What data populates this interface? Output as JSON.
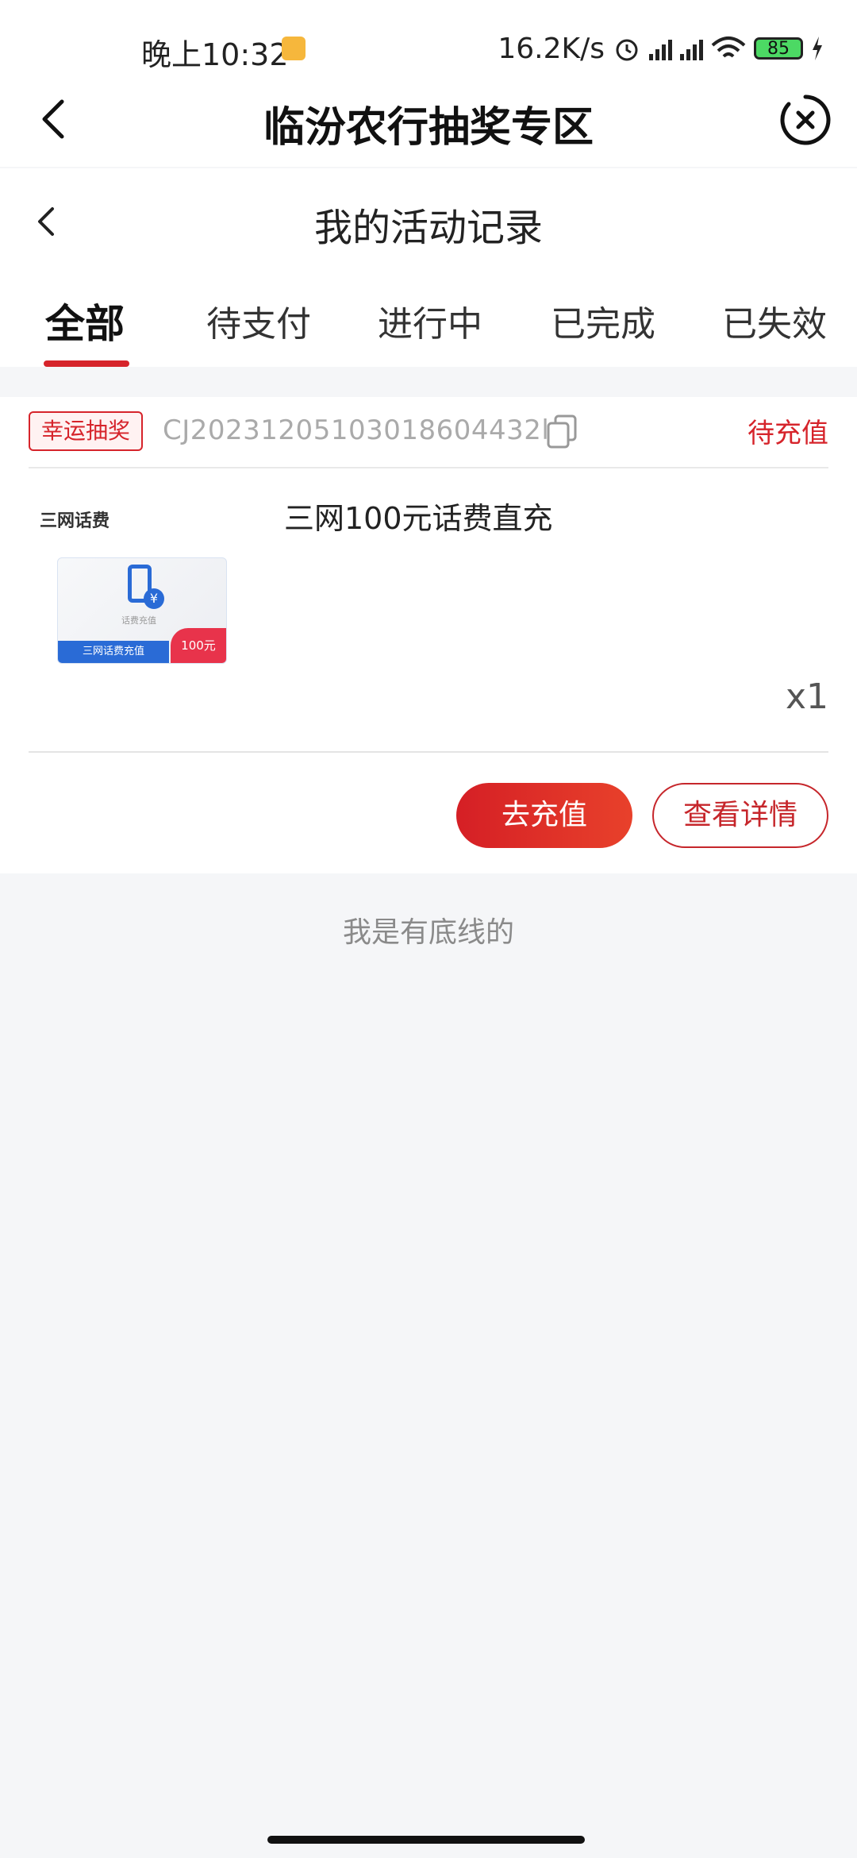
{
  "status_bar": {
    "time": "晚上10:32",
    "network_speed": "16.2K/s",
    "battery_level": "85"
  },
  "nav": {
    "title": "临汾农行抽奖专区"
  },
  "page": {
    "title": "我的活动记录"
  },
  "tabs": [
    {
      "label": "全部",
      "active": true
    },
    {
      "label": "待支付",
      "active": false
    },
    {
      "label": "进行中",
      "active": false
    },
    {
      "label": "已完成",
      "active": false
    },
    {
      "label": "已失效",
      "active": false
    }
  ],
  "order": {
    "badge": "幸运抽奖",
    "order_no": "CJ20231205103018604432l",
    "status": "待充值",
    "category": "三网话费",
    "product_name": "三网100元话费直充",
    "image_caption": "话费充值",
    "image_strip": "三网话费充值",
    "image_price": "100元",
    "quantity": "x1",
    "recharge_label": "去充值",
    "detail_label": "查看详情"
  },
  "footer": {
    "bottom_text": "我是有底线的"
  },
  "colors": {
    "accent": "#d6242b",
    "background": "#f5f6f8"
  }
}
